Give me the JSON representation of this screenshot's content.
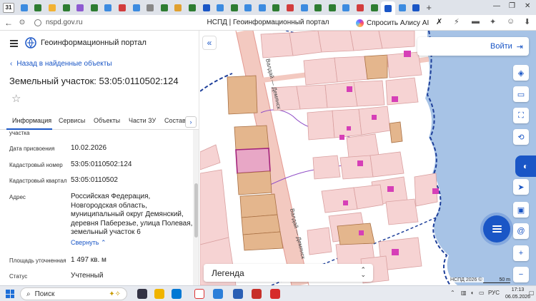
{
  "browser": {
    "tab_counter": "31",
    "favicon_colors": [
      "#3c8be0",
      "#2e7d32",
      "#f2b233",
      "#2e7d32",
      "#8e5bd1",
      "#2e7d32",
      "#3c8be0",
      "#d23d3d",
      "#3c8be0",
      "#888888",
      "#2e7d32",
      "#e0a030",
      "#2e7d32",
      "#1a56c6",
      "#3c8be0",
      "#2e7d32",
      "#3c8be0",
      "#3c8be0",
      "#2e7d32",
      "#d23d3d",
      "#3c8be0",
      "#2e7d32",
      "#2e7d32",
      "#3c8be0",
      "#d23d3d",
      "#2e7d32",
      "#1a56c6",
      "#3c8be0",
      "#1a56c6"
    ],
    "url": "nspd.gov.ru",
    "page_title": "НСПД | Геоинформационный портал",
    "alice_label": "Спросить Алису AI"
  },
  "panel": {
    "portal_name": "Геоинформационный портал",
    "back_link": "Назад в найденные объекты",
    "title": "Земельный участок: 53:05:0110502:124",
    "tabs": [
      "Информация",
      "Сервисы",
      "Объекты",
      "Части ЗУ",
      "Состав"
    ],
    "rows": [
      {
        "label": "участка",
        "value": ""
      },
      {
        "label": "Дата присвоения",
        "value": "10.02.2026"
      },
      {
        "label": "Кадастровый номер",
        "value": "53:05:0110502:124"
      },
      {
        "label": "Кадастровый квартал",
        "value": "53:05:0110502"
      },
      {
        "label": "Адрес",
        "value_lines": [
          "Российская Федерация,",
          "Новгородская область,",
          "муниципальный округ Демянский,",
          "деревня Паберезье, улица Полевая,",
          "земельный участок 6"
        ]
      },
      {
        "label": "Площадь уточненная",
        "value": "1 497 кв. м"
      },
      {
        "label": "Статус",
        "value": "Учтенный"
      }
    ],
    "collapse_label": "Свернуть"
  },
  "map": {
    "street_label_top": "Валдай — Демянск",
    "street_label_bottom": "Валдай — Демянск",
    "login_label": "Войти",
    "legend_label": "Легенда",
    "attribution": "НСПД 2026 ©",
    "scale_label": "50 m",
    "colors": {
      "parcel_fill": "#f6d3d3",
      "parcel_stroke": "#d9a0a0",
      "selected_fill": "#e8a7c6",
      "selected_stroke": "#a3237b",
      "brown_fill": "#e4b68d",
      "brown_stroke": "#a86f43",
      "building": "#d63fb7",
      "water": "#a7c3e6",
      "accent": "#1a56c6"
    }
  },
  "taskbar": {
    "search_label": "Поиск",
    "lang": "РУС",
    "time": "17:13",
    "date": "06.05.2026"
  }
}
